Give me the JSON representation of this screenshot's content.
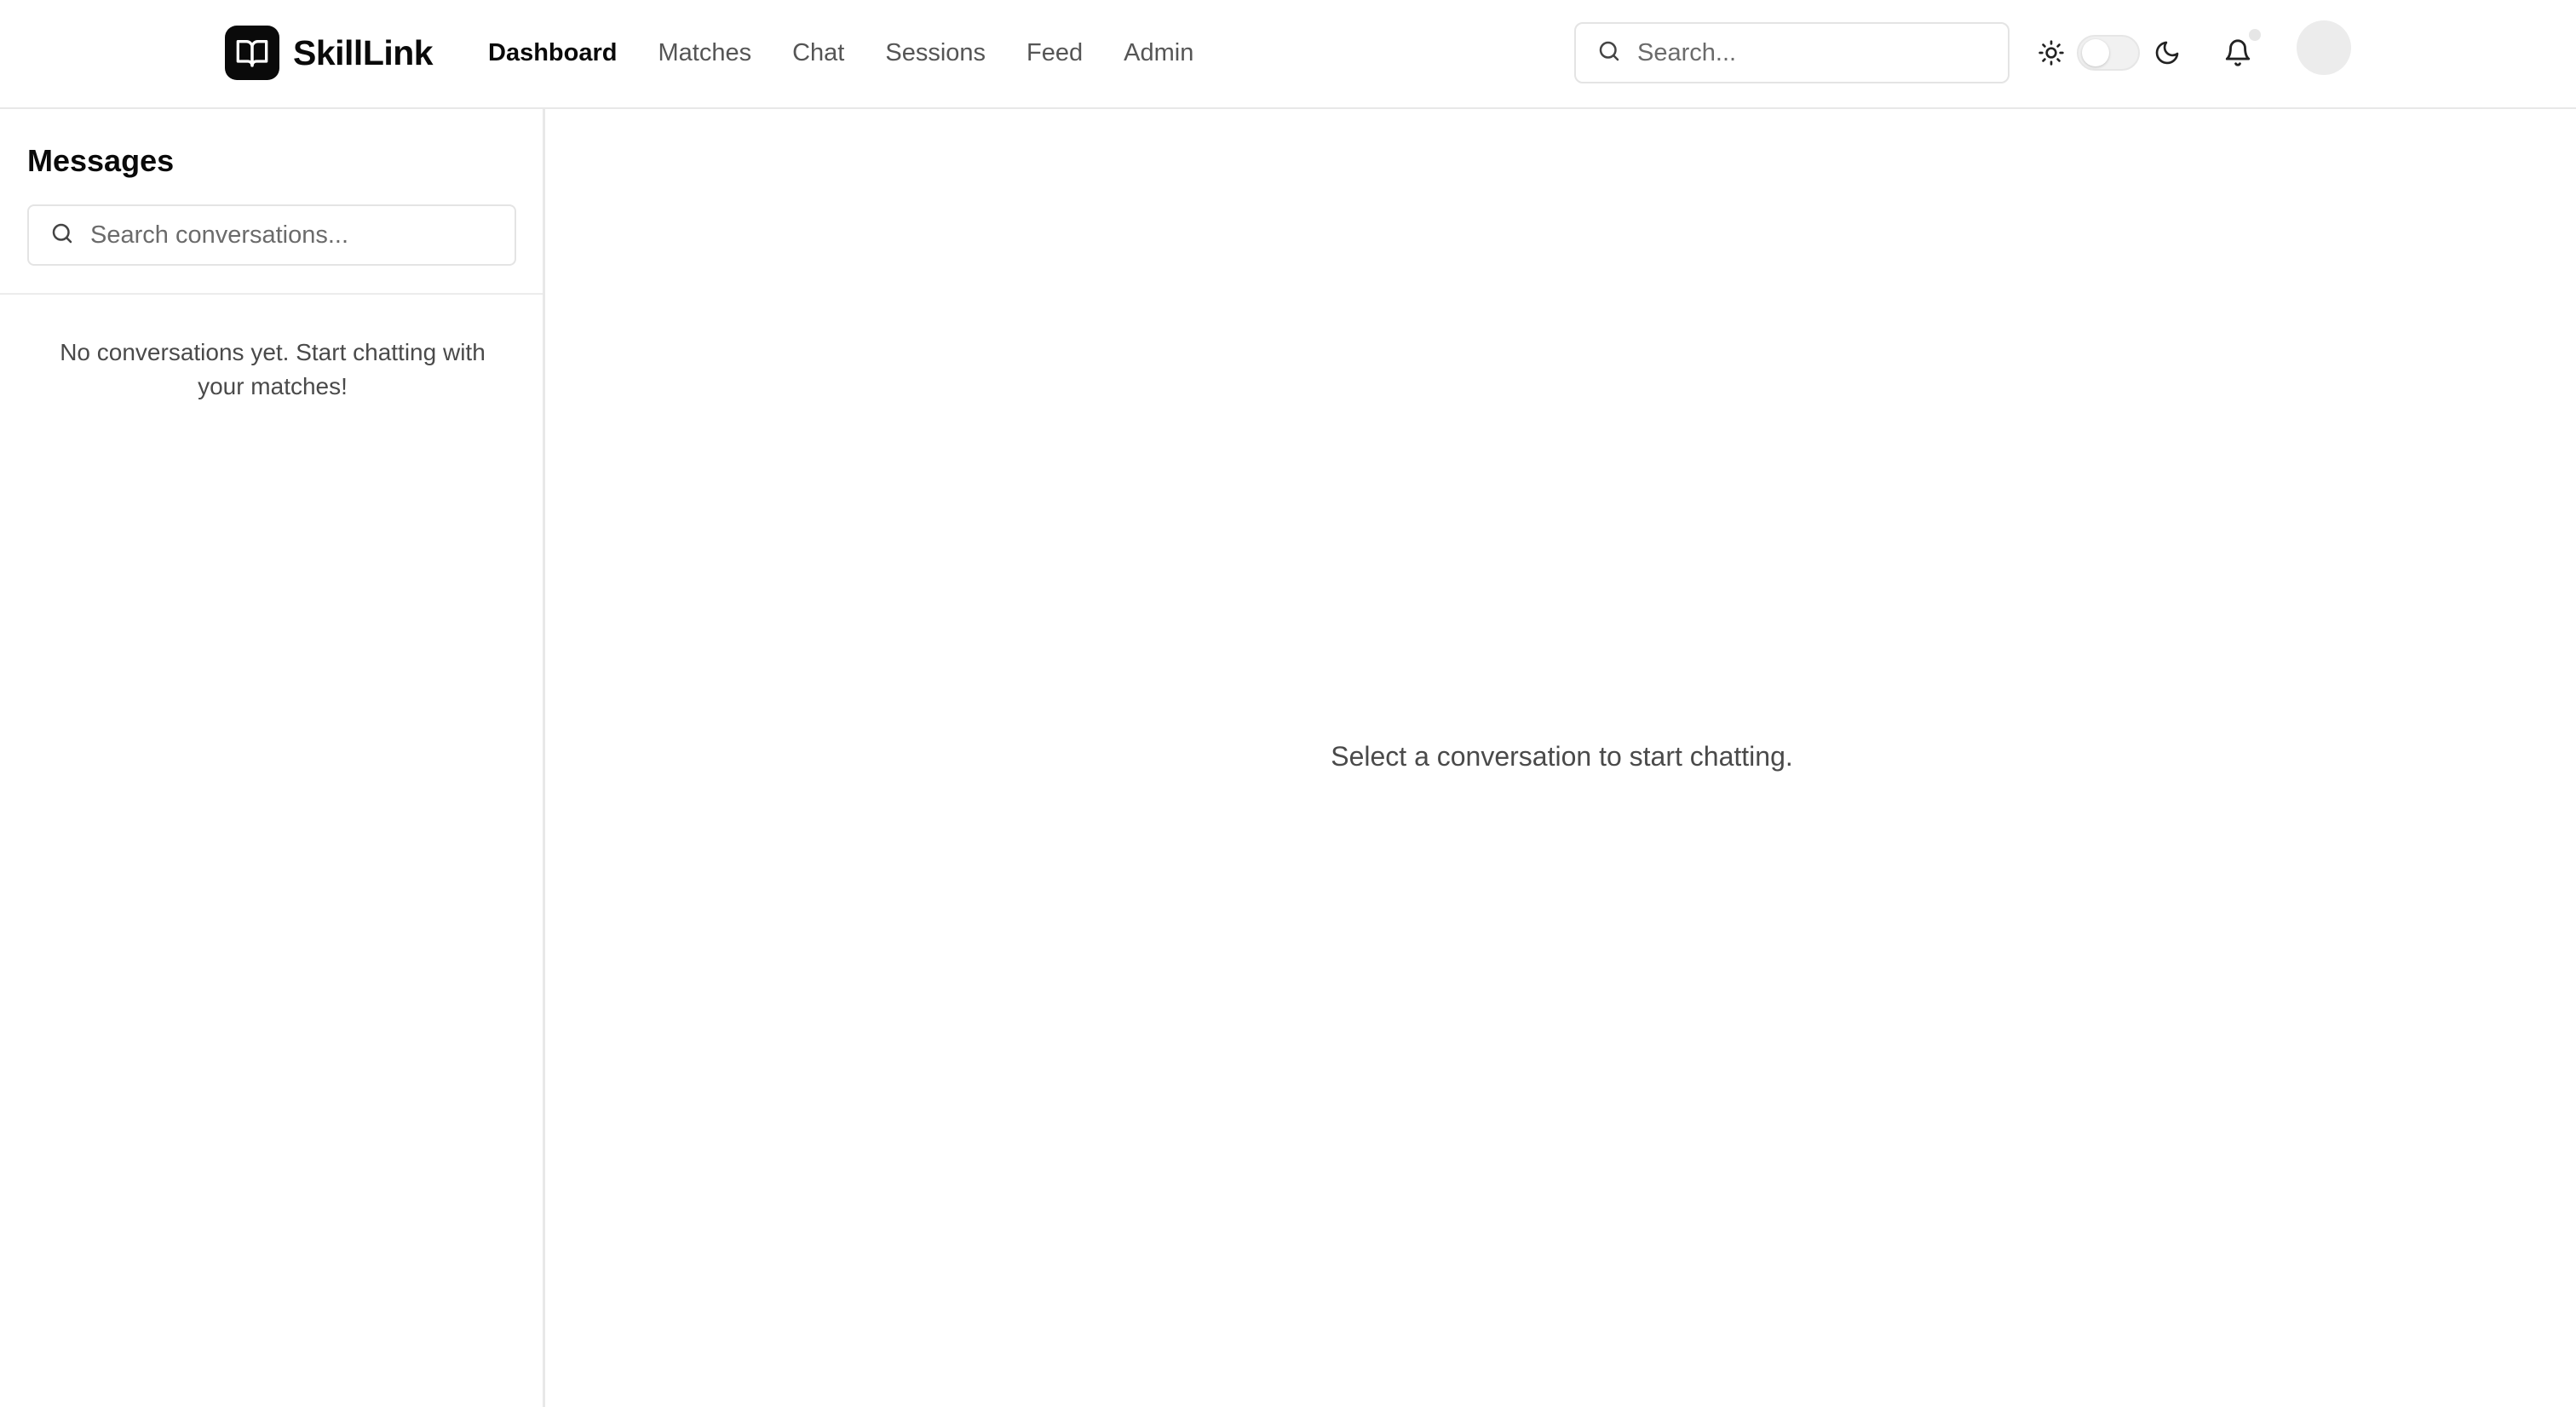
{
  "header": {
    "brand": {
      "name": "SkillLink",
      "icon": "open-book-icon"
    },
    "nav": [
      {
        "label": "Dashboard",
        "active": true
      },
      {
        "label": "Matches",
        "active": false
      },
      {
        "label": "Chat",
        "active": false
      },
      {
        "label": "Sessions",
        "active": false
      },
      {
        "label": "Feed",
        "active": false
      },
      {
        "label": "Admin",
        "active": false
      }
    ],
    "search": {
      "placeholder": "Search...",
      "value": "",
      "icon": "search-icon"
    },
    "theme": {
      "light_icon": "sun-icon",
      "dark_icon": "moon-icon",
      "dark_mode": false
    },
    "notifications": {
      "icon": "bell-icon"
    },
    "avatar": {
      "icon": "avatar"
    }
  },
  "sidebar": {
    "title": "Messages",
    "search": {
      "placeholder": "Search conversations...",
      "value": "",
      "icon": "search-icon"
    },
    "empty_text": "No conversations yet. Start chatting with your matches!"
  },
  "main": {
    "placeholder": "Select a conversation to start chatting."
  },
  "colors": {
    "brand_bg": "#0a0a0a",
    "active_text": "#0a0a0a",
    "muted_text": "#555555",
    "border": "#e4e4e4"
  }
}
